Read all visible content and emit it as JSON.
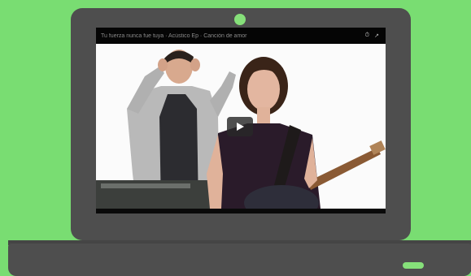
{
  "video": {
    "title": "Tu fuerza nunca fue tuya · Acústico Ep · Canción de amor",
    "icons": [
      "clock-icon",
      "share-icon"
    ],
    "play_icon": "play-icon"
  },
  "colors": {
    "background": "#79dd72",
    "laptop_body": "#4e4e4e",
    "webcam_light": "#86e07a"
  }
}
